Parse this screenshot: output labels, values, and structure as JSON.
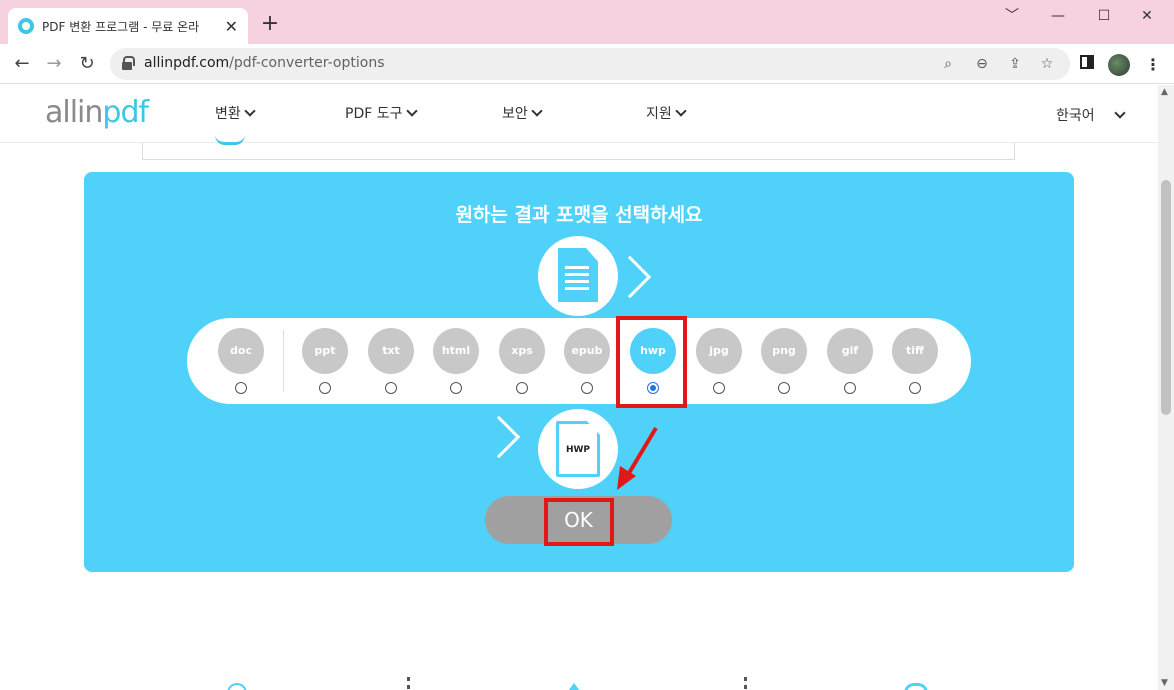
{
  "browser": {
    "tab_title": "PDF 변환 프로그램 - 무료 온라",
    "tab_close": "✕",
    "new_tab": "+",
    "url_host": "allinpdf.com",
    "url_path": "/pdf-converter-options",
    "window_controls": {
      "minimize": "﹀",
      "restore": "—",
      "maximize": "☐",
      "close": "✕"
    },
    "nav": {
      "back": "←",
      "forward": "→",
      "reload": "↻"
    },
    "omni_icons": {
      "search": "⌕",
      "zoom": "⊖",
      "share": "⇪",
      "bookmark": "☆"
    }
  },
  "site": {
    "logo_prefix": "allin",
    "logo_suffix": "pdf",
    "menu": [
      {
        "label": "변환"
      },
      {
        "label": "PDF 도구"
      },
      {
        "label": "보안"
      },
      {
        "label": "지원"
      }
    ],
    "language": "한국어"
  },
  "converter": {
    "title": "원하는 결과 포맷을 선택하세요",
    "formats": [
      {
        "label": "doc",
        "selected": false
      },
      {
        "label": "ppt",
        "selected": false
      },
      {
        "label": "txt",
        "selected": false
      },
      {
        "label": "html",
        "selected": false
      },
      {
        "label": "xps",
        "selected": false
      },
      {
        "label": "epub",
        "selected": false
      },
      {
        "label": "hwp",
        "selected": true
      },
      {
        "label": "jpg",
        "selected": false
      },
      {
        "label": "png",
        "selected": false
      },
      {
        "label": "gif",
        "selected": false
      },
      {
        "label": "tiff",
        "selected": false
      }
    ],
    "output_icon_label": "HWP",
    "ok_label": "OK",
    "accent_color": "#4fd1f9",
    "highlight_color": "#e01818"
  }
}
